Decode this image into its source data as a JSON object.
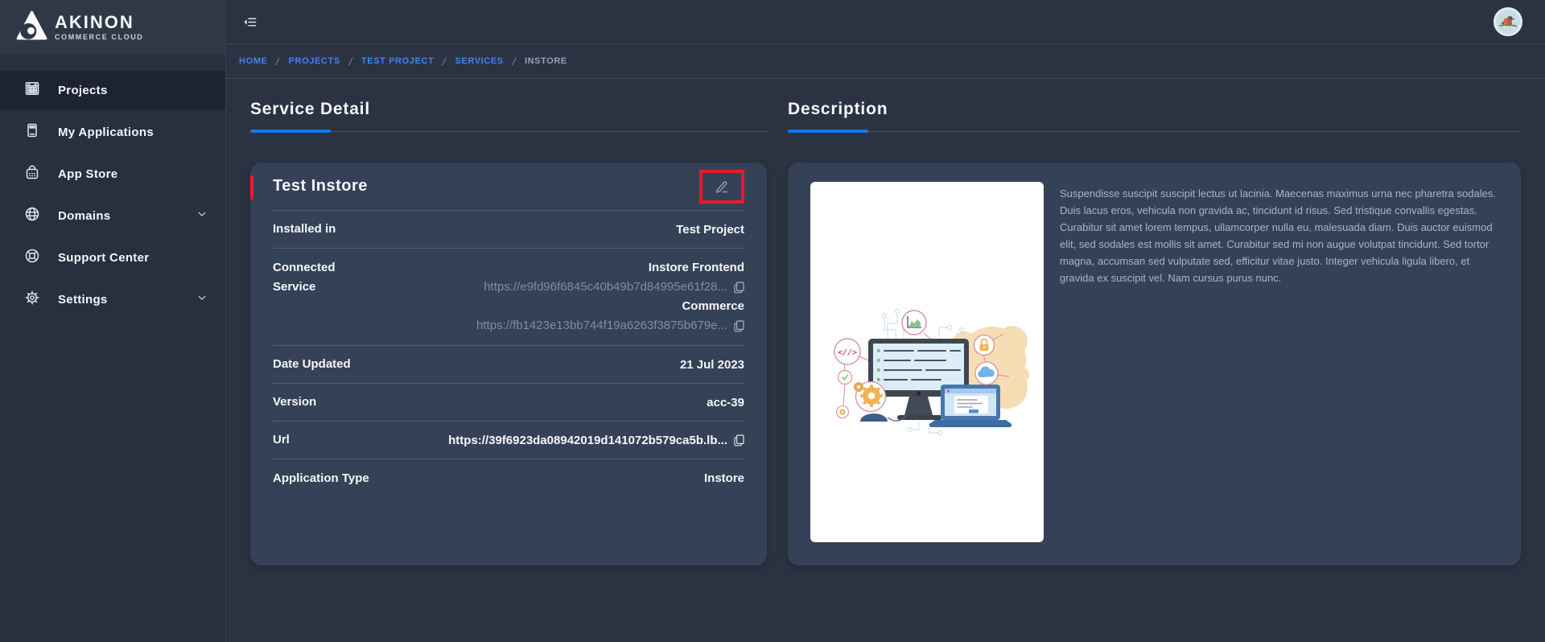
{
  "brand": {
    "name": "AKINON",
    "tagline": "COMMERCE CLOUD"
  },
  "sidebar": {
    "items": [
      {
        "label": "Projects",
        "icon": "grid-icon",
        "active": true
      },
      {
        "label": "My Applications",
        "icon": "applications-icon",
        "active": false
      },
      {
        "label": "App Store",
        "icon": "shopping-bag-icon",
        "active": false
      },
      {
        "label": "Domains",
        "icon": "globe-icon",
        "active": false,
        "expandable": true
      },
      {
        "label": "Support Center",
        "icon": "life-ring-icon",
        "active": false
      },
      {
        "label": "Settings",
        "icon": "gear-icon",
        "active": false,
        "expandable": true
      }
    ]
  },
  "breadcrumb": {
    "items": [
      "HOME",
      "PROJECTS",
      "TEST PROJECT",
      "SERVICES",
      "INSTORE"
    ]
  },
  "service_detail": {
    "section_title": "Service Detail",
    "card_title": "Test Instore",
    "installed_in": {
      "label": "Installed in",
      "value": "Test Project"
    },
    "connected_service": {
      "label_line1": "Connected",
      "label_line2": "Service",
      "entries": [
        {
          "name": "Instore Frontend",
          "url": "https://e9fd96f6845c40b49b7d84995e61f28..."
        },
        {
          "name": "Commerce",
          "url": "https://fb1423e13bb744f19a6263f3875b679e..."
        }
      ]
    },
    "date_updated": {
      "label": "Date Updated",
      "value": "21 Jul 2023"
    },
    "version": {
      "label": "Version",
      "value": "acc-39"
    },
    "url": {
      "label": "Url",
      "value": "https://39f6923da08942019d141072b579ca5b.lb..."
    },
    "application_type": {
      "label": "Application Type",
      "value": "Instore"
    }
  },
  "description": {
    "section_title": "Description",
    "text": "Suspendisse suscipit suscipit lectus ut lacinia. Maecenas maximus urna nec pharetra sodales. Duis lacus eros, vehicula non gravida ac, tincidunt id risus. Sed tristique convallis egestas. Curabitur sit amet lorem tempus, ullamcorper nulla eu, malesuada diam. Duis auctor euismod elit, sed sodales est mollis sit amet. Curabitur sed mi non augue volutpat tincidunt. Sed tortor magna, accumsan sed vulputate sed, efficitur vitae justo. Integer vehicula ligula libero, et gravida ex suscipit vel. Nam cursus purus nunc."
  },
  "colors": {
    "accent_blue": "#1776ee",
    "breadcrumb_blue": "#4584ec",
    "accent_red": "#ee1c2e",
    "highlight_red": "#e8192b",
    "page_bg": "#2b3342",
    "card_bg": "#354157",
    "sidebar_bg": "#27303f",
    "muted_text": "#848ca0"
  }
}
